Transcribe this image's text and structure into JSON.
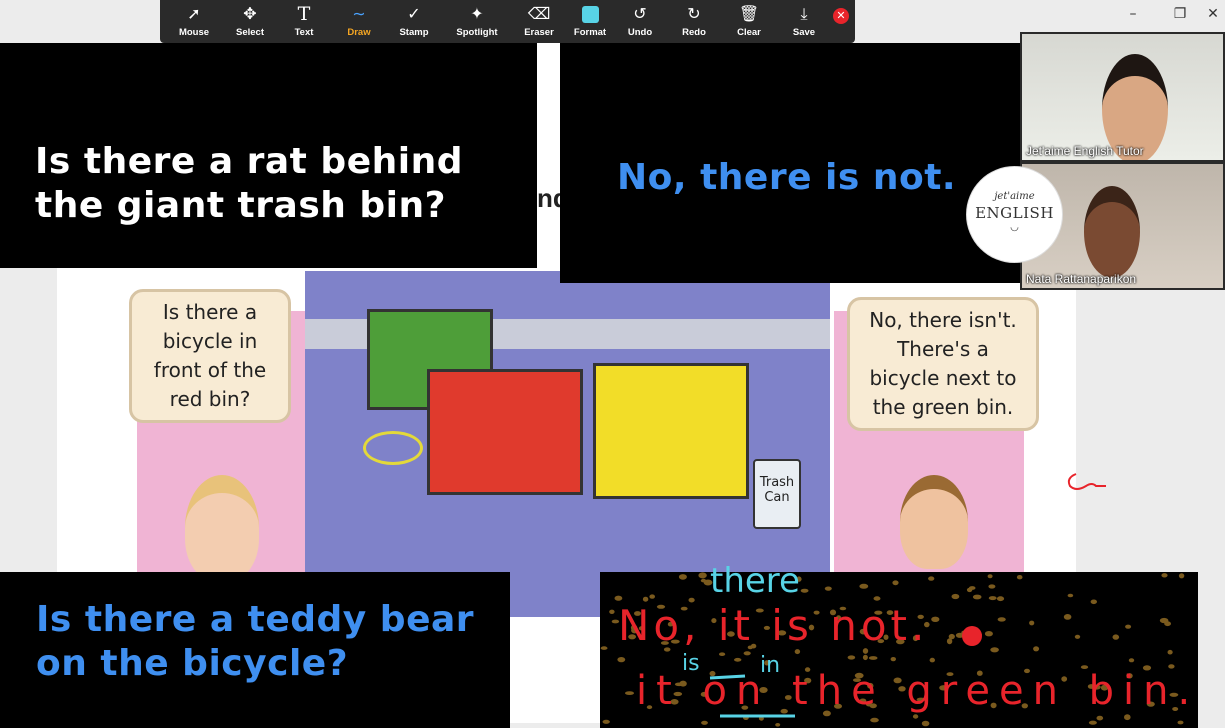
{
  "toolbar": {
    "tools": [
      {
        "name": "mouse",
        "label": "Mouse",
        "icon": "➚"
      },
      {
        "name": "select",
        "label": "Select",
        "icon": "✥"
      },
      {
        "name": "text",
        "label": "Text",
        "icon": "T"
      },
      {
        "name": "draw",
        "label": "Draw",
        "icon": "∼"
      },
      {
        "name": "stamp",
        "label": "Stamp",
        "icon": "✓"
      },
      {
        "name": "spotlight",
        "label": "Spotlight",
        "icon": "✦"
      },
      {
        "name": "eraser",
        "label": "Eraser",
        "icon": "⌫"
      },
      {
        "name": "format",
        "label": "Format",
        "icon": ""
      },
      {
        "name": "undo",
        "label": "Undo",
        "icon": "↺"
      },
      {
        "name": "redo",
        "label": "Redo",
        "icon": "↻"
      },
      {
        "name": "clear",
        "label": "Clear",
        "icon": "🗑"
      },
      {
        "name": "save",
        "label": "Save",
        "icon": "⤓"
      }
    ],
    "active": "Draw",
    "format_color": "#58d3e6"
  },
  "window": {
    "minimize": "–",
    "restore": "❐",
    "close": "✕"
  },
  "overlay": {
    "question1": [
      "Is there a rat behind",
      "the giant trash bin?"
    ],
    "answer1": "No, there is not.",
    "question2": [
      "Is there a teddy bear",
      "on the bicycle?"
    ]
  },
  "slide": {
    "heading_fragment": "nd",
    "bubble_left": [
      "Is there a",
      "bicycle in",
      "front of the",
      "red bin?"
    ],
    "bubble_right": [
      "No, there isn't.",
      "There's a",
      "bicycle next to",
      "the green bin."
    ],
    "trash_can": [
      "Trash",
      "Can"
    ]
  },
  "video": [
    {
      "name": "Jet'aime English Tutor"
    },
    {
      "name": "Nata Rattanaparikon"
    }
  ],
  "logo": {
    "top": "jet'aime",
    "main": "ENGLISH",
    "smile": "◡"
  },
  "handwriting": {
    "line1": "No, it is not.",
    "line1_insert": "there",
    "line2": "it on the green bin.",
    "line2_insert_is": "is",
    "line2_insert_in": "in"
  },
  "colors": {
    "accent_blue": "#3f8ff0",
    "ink_red": "#e8242b",
    "ink_cyan": "#58d3e6",
    "toolbar_bg": "#2a2a2a"
  }
}
